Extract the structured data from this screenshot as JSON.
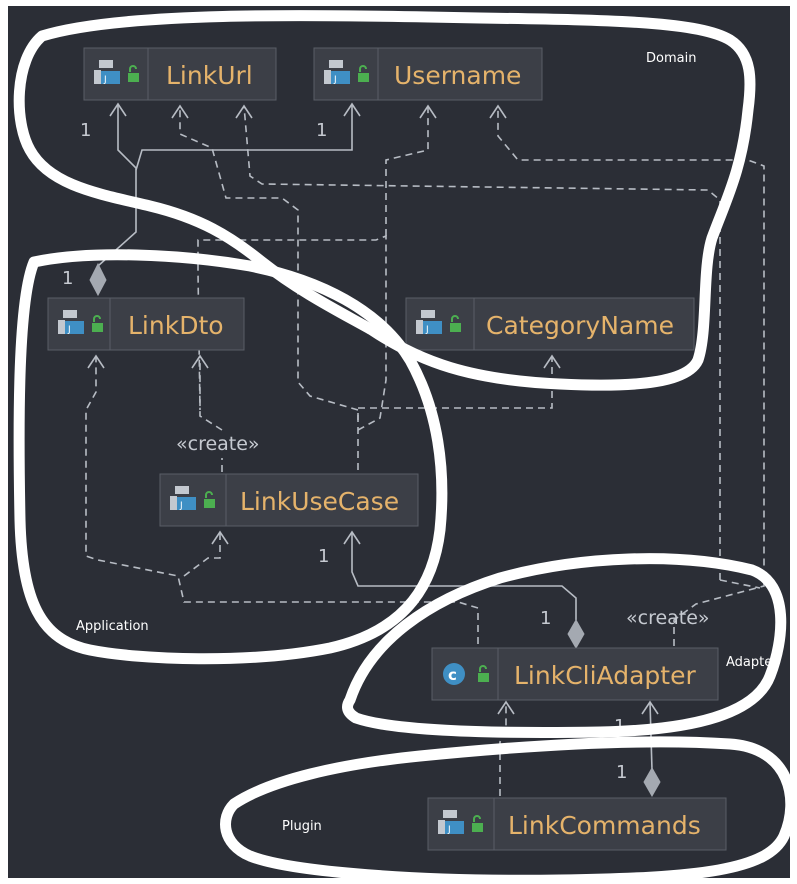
{
  "nodes": [
    {
      "id": "linkurl",
      "label": "LinkUrl",
      "kind": "record"
    },
    {
      "id": "username",
      "label": "Username",
      "kind": "record"
    },
    {
      "id": "linkdto",
      "label": "LinkDto",
      "kind": "record"
    },
    {
      "id": "categoryname",
      "label": "CategoryName",
      "kind": "record"
    },
    {
      "id": "linkusecase",
      "label": "LinkUseCase",
      "kind": "record"
    },
    {
      "id": "linkcliadapter",
      "label": "LinkCliAdapter",
      "kind": "class"
    },
    {
      "id": "linkcommands",
      "label": "LinkCommands",
      "kind": "record"
    }
  ],
  "regions": {
    "domain": "Domain",
    "application": "Application",
    "adapter": "Adapter",
    "plugin": "Plugin"
  },
  "labels": {
    "create_usecase": "«create»",
    "create_adapter": "«create»",
    "one": "1"
  },
  "colors": {
    "background": "#2b2e36",
    "node_fill": "#3c3f47",
    "node_text": "#e5b36b",
    "edge": "#b7bcc4",
    "highlight": "#ffffff",
    "class_badge": "#3f8fc4",
    "lock_green": "#4caf50"
  },
  "icons": {
    "record": "record-file-icon",
    "class": "class-c-icon",
    "lock": "open-lock-icon"
  }
}
